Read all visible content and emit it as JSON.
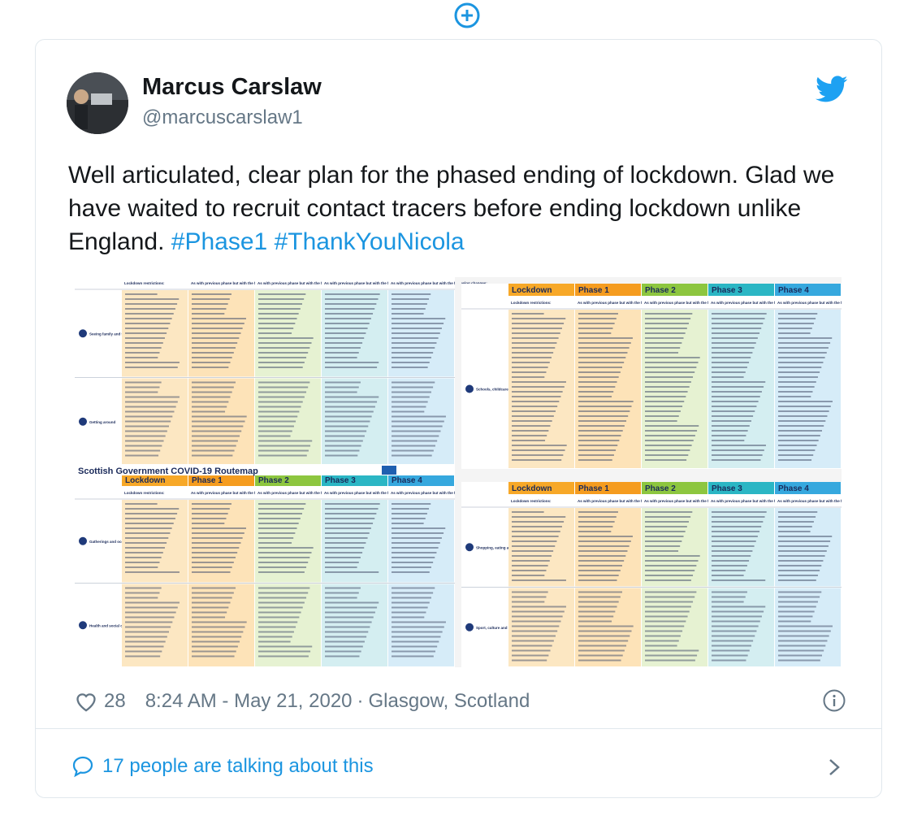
{
  "tweet": {
    "author_name": "Marcus Carslaw",
    "author_handle": "@marcuscarslaw1",
    "text_plain": "Well articulated, clear plan for the phased ending of lockdown. Glad we have waited to recruit contact tracers before ending lockdown unlike England. ",
    "hashtags": [
      "#Phase1",
      "#ThankYouNicola"
    ],
    "likes": "28",
    "timestamp": "8:24 AM - May 21, 2020",
    "separator": "·",
    "location": "Glasgow, Scotland",
    "talking": "17 people are talking about this"
  },
  "media": {
    "banner_title": "Scottish Government COVID-19 Routemap",
    "phase_headers": [
      "Lockdown",
      "Phase 1",
      "Phase 2",
      "Phase 3",
      "Phase 4"
    ],
    "row_labels": [
      "Seeing family and friends",
      "Getting around",
      "Gatherings and occasions",
      "Health and social care",
      "Schools, childcare and other educational settings",
      "Shopping, eating and drinking out",
      "Sport, culture and leisure activities"
    ],
    "header_subtitle": "As with previous phase but with the following changes:",
    "lockdown_subtitle": "Lockdown restrictions:"
  },
  "colors": {
    "accent": "#1b95e0",
    "text_secondary": "#657786",
    "lockdown": "#f7a828",
    "phase1": "#f59c1f",
    "phase2": "#8dc63f",
    "phase3": "#2bb6c4",
    "phase4": "#36a8de"
  },
  "icons": [
    "plus-circle-icon",
    "twitter-bird-icon",
    "heart-icon",
    "info-icon",
    "comment-bubble-icon",
    "chevron-right-icon"
  ]
}
